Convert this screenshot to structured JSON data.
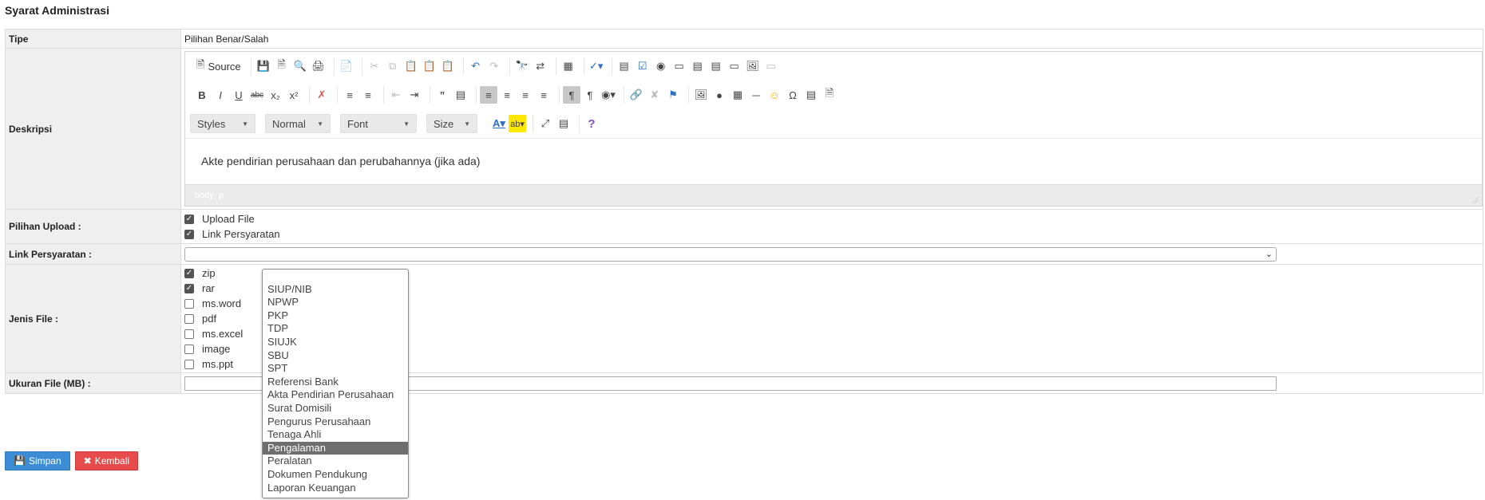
{
  "page_title": "Syarat Administrasi",
  "form": {
    "tipe": {
      "label": "Tipe",
      "value": "Pilihan Benar/Salah"
    },
    "deskripsi": {
      "label": "Deskripsi",
      "toolbar": {
        "source_label": "Source",
        "styles_label": "Styles",
        "format_label": "Normal",
        "font_label": "Font",
        "size_label": "Size"
      },
      "content": "Akte pendirian perusahaan dan perubahannya (jika ada)",
      "path": [
        "body",
        "p"
      ]
    },
    "pilihan_upload": {
      "label": "Pilihan Upload :",
      "options": [
        {
          "label": "Upload File",
          "checked": true
        },
        {
          "label": "Link Persyaratan",
          "checked": true
        }
      ]
    },
    "link_persyaratan": {
      "label": "Link Persyaratan :",
      "value": ""
    },
    "jenis_file": {
      "label": "Jenis File :",
      "options": [
        {
          "label": "zip",
          "checked": true
        },
        {
          "label": "rar",
          "checked": true
        },
        {
          "label": "ms.word",
          "checked": false
        },
        {
          "label": "pdf",
          "checked": false
        },
        {
          "label": "ms.excel",
          "checked": false
        },
        {
          "label": "image",
          "checked": false
        },
        {
          "label": "ms.ppt",
          "checked": false
        }
      ]
    },
    "ukuran_file": {
      "label": "Ukuran File (MB) :",
      "value": ""
    }
  },
  "buttons": {
    "save_label": "Simpan",
    "back_label": "Kembali"
  },
  "dropdown": {
    "selected": "Pengalaman",
    "options": [
      "",
      "SIUP/NIB",
      "NPWP",
      "PKP",
      "TDP",
      "SIUJK",
      "SBU",
      "SPT",
      "Referensi Bank",
      "Akta Pendirian Perusahaan",
      "Surat Domisili",
      "Pengurus Perusahaan",
      "Tenaga Ahli",
      "Pengalaman",
      "Peralatan",
      "Dokumen Pendukung",
      "Laporan Keuangan"
    ]
  },
  "colors": {
    "save": "#3c8dd6",
    "back": "#e84b4b",
    "label_bg": "#efefef",
    "selected_option": "#6e6e6e"
  }
}
